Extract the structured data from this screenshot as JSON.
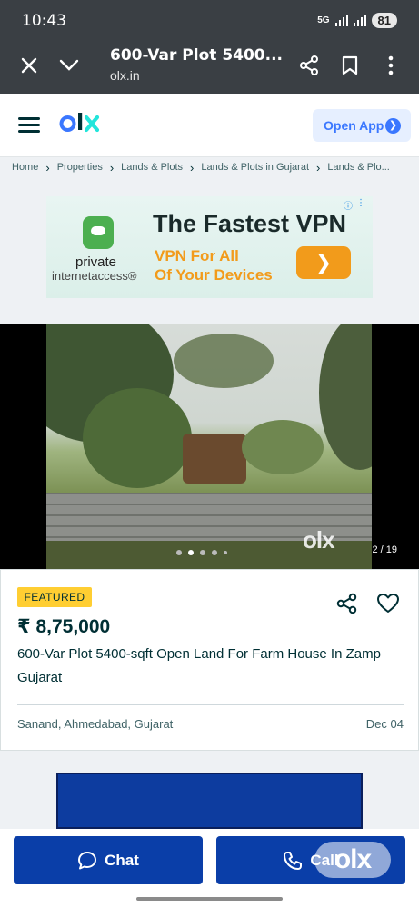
{
  "status_bar": {
    "time": "10:43",
    "network": "5G",
    "battery": "81"
  },
  "custom_tab": {
    "title": "600-Var Plot 5400...",
    "url": "olx.in"
  },
  "header": {
    "logo": "olx",
    "open_app_label": "Open App"
  },
  "breadcrumb": [
    "Home",
    "Properties",
    "Lands & Plots",
    "Lands & Plots in Gujarat",
    "Lands & Plo..."
  ],
  "ad": {
    "brand_line1": "private",
    "brand_line2": "internetaccess®",
    "headline": "The Fastest VPN",
    "subline1": "VPN For All",
    "subline2": "Of Your Devices"
  },
  "gallery": {
    "counter": "2 / 19",
    "watermark": "olx",
    "active_index": 1,
    "dots_visible": 5
  },
  "listing": {
    "badge": "FEATURED",
    "price": "₹ 8,75,000",
    "title": "600-Var Plot 5400-sqft Open Land For Farm House In Zamp Gujarat",
    "location": "Sanand, Ahmedabad, Gujarat",
    "date": "Dec 04"
  },
  "actions": {
    "chat_label": "Chat",
    "call_label": "Call"
  },
  "colors": {
    "brand_blue": "#3a77ff",
    "button_blue": "#0a3ea8",
    "featured_yellow": "#ffce32",
    "text_dark": "#002f34"
  }
}
